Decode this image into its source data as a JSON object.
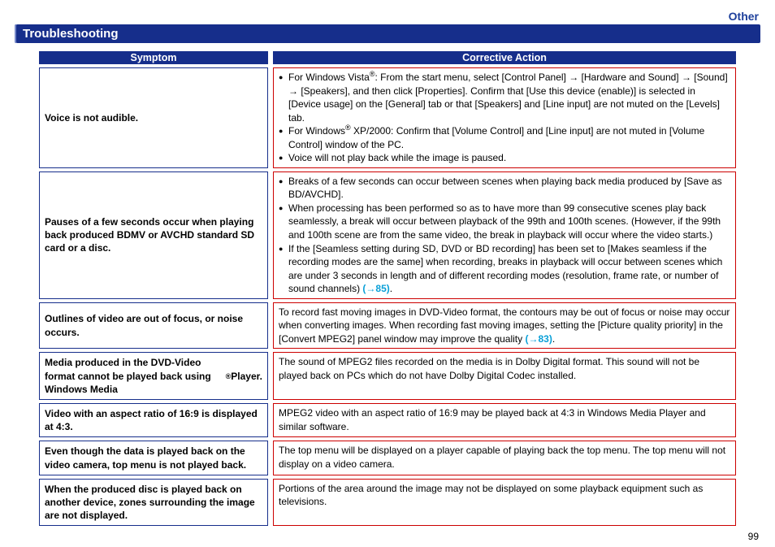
{
  "section_label": "Other",
  "title": "Troubleshooting",
  "headers": {
    "left": "Symptom",
    "right": "Corrective Action"
  },
  "rows": [
    {
      "symptom": "Voice is not audible.",
      "actions_html": "<ul><li>For Windows Vista<span class='reg'>®</span>: From the start menu, select [Control Panel] → [Hardware and Sound] → [Sound] → [Speakers], and then click [Properties]. Confirm that [Use this device (enable)] is selected in [Device usage] on the [General] tab or that [Speakers] and [Line input] are not muted on the [Levels] tab.</li><li>For Windows<span class='reg'>®</span> XP/2000: Confirm that [Volume Control] and [Line input] are not muted in [Volume Control] window of the PC.</li><li>Voice will not play back while the image is paused.</li></ul>"
    },
    {
      "symptom": "Pauses of a few seconds occur when playing back produced BDMV or AVCHD standard SD card or a disc.",
      "actions_html": "<ul><li>Breaks of a few seconds can occur between scenes when playing back media produced by [Save as BD/AVCHD].</li><li>When processing has been performed so as to have more than 99 consecutive scenes play back seamlessly, a break will occur between playback of the 99th and 100th scenes. (However, if the 99th and 100th scene are from the same video, the break in playback will occur where the video starts.)</li><li>If the [Seamless setting during SD, DVD or BD recording] has been set to [Makes seamless if the recording modes are the same] when recording, breaks in playback will occur between scenes which are under 3 seconds in length and of different recording modes (resolution, frame rate, or number of sound channels) <span class='link'>(→85)</span>.</li></ul>"
    },
    {
      "symptom": "Outlines of video are out of focus, or noise occurs.",
      "actions_html": "<div class='plain'>To record fast moving images in DVD-Video format, the contours may be out of focus or noise may occur when converting images. When recording fast moving images, setting the [Picture quality priority] in the [Convert MPEG2] panel window may improve the quality <span class='link'>(→83)</span>.</div>"
    },
    {
      "symptom_html": "Media produced in the DVD-Video format cannot be played back using Windows Media<span class='reg'>®</span> Player.",
      "actions_html": "<div class='plain'>The sound of MPEG2 files recorded on the media is in Dolby Digital format. This sound will not be played back on PCs which do not have Dolby Digital Codec installed.</div>"
    },
    {
      "symptom": "Video with an aspect ratio of 16:9 is displayed at 4:3.",
      "actions_html": "<div class='plain'>MPEG2 video with an aspect ratio of 16:9 may be played back at 4:3 in Windows Media Player and similar software.</div>"
    },
    {
      "symptom": "Even though the data is played back on the video camera, top menu is not played back.",
      "actions_html": "<div class='plain'>The top menu will be displayed on a player capable of playing back the top menu. The top menu will not display on a video camera.</div>"
    },
    {
      "symptom": "When the produced disc is played back on another device, zones surrounding the image are not displayed.",
      "actions_html": "<div class='plain'>Portions of the area around the image may not be displayed on some playback equipment such as televisions.</div>"
    }
  ],
  "page_number": "99"
}
